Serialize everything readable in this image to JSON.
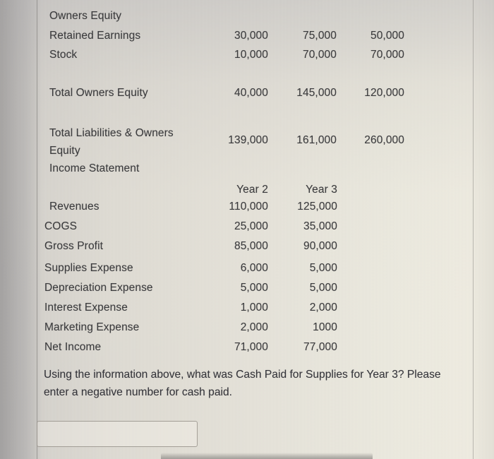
{
  "document": {
    "kind": "accounting-worksheet-photo",
    "balance_sheet": {
      "section_title": "Owners Equity",
      "rows": [
        {
          "label": "Retained Earnings",
          "c1": "30,000",
          "c2": "75,000",
          "c3": "50,000"
        },
        {
          "label": "Stock",
          "c1": "10,000",
          "c2": "70,000",
          "c3": "70,000"
        }
      ],
      "totals": [
        {
          "label": "Total Owners Equity",
          "c1": "40,000",
          "c2": "145,000",
          "c3": "120,000"
        },
        {
          "label": "Total Liabilities & Owners Equity",
          "c1": "139,000",
          "c2": "161,000",
          "c3": "260,000"
        }
      ]
    },
    "income_statement": {
      "section_title": "Income Statement",
      "column_headers": [
        "Year 2",
        "Year 3"
      ],
      "rows": [
        {
          "label": "Revenues",
          "y2": "110,000",
          "y3": "125,000"
        },
        {
          "label": "COGS",
          "y2": "25,000",
          "y3": "35,000"
        },
        {
          "label": "Gross Profit",
          "y2": "85,000",
          "y3": "90,000"
        },
        {
          "label": "Supplies Expense",
          "y2": "6,000",
          "y3": "5,000"
        },
        {
          "label": "Depreciation Expense",
          "y2": "5,000",
          "y3": "5,000"
        },
        {
          "label": "Interest Expense",
          "y2": "1,000",
          "y3": "2,000"
        },
        {
          "label": "Marketing Expense",
          "y2": "2,000",
          "y3": "1000"
        },
        {
          "label": "Net Income",
          "y2": "71,000",
          "y3": "77,000"
        }
      ]
    },
    "question": {
      "text": "Using the information above, what was Cash Paid for Supplies for Year 3? Please enter a negative number for cash paid."
    },
    "answer": {
      "value": "",
      "placeholder": ""
    }
  },
  "colors": {
    "text": "#3b3b3d",
    "rule": "#78766e",
    "surface_light": "#efece1",
    "surface_dark": "#b9b7b6"
  }
}
